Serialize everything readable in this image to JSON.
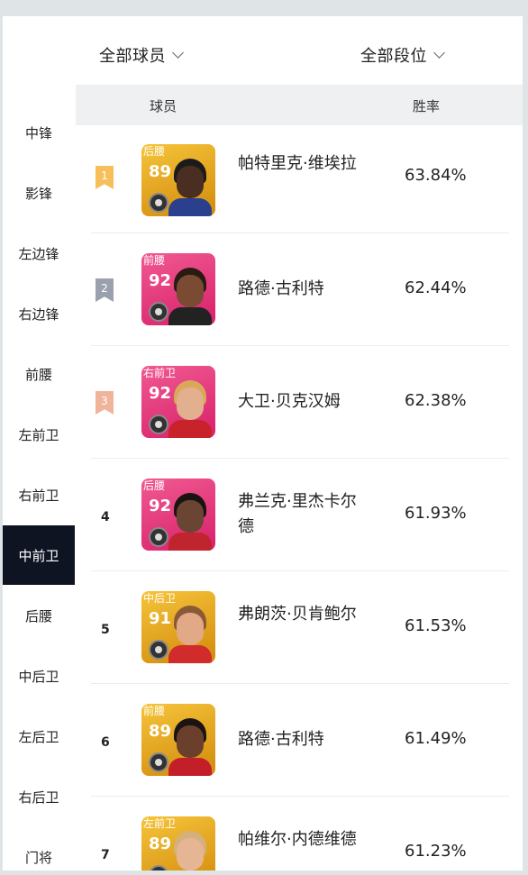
{
  "filters": {
    "players": "全部球员",
    "tier": "全部段位"
  },
  "header": {
    "player_col": "球员",
    "winrate_col": "胜率"
  },
  "positions": [
    "中锋",
    "影锋",
    "左边锋",
    "右边锋",
    "前腰",
    "左前卫",
    "右前卫",
    "中前卫",
    "后腰",
    "中后卫",
    "左后卫",
    "右后卫",
    "门将"
  ],
  "active_position": "中前卫",
  "colors": {
    "gold": "#f3b11a",
    "pink": "#e6357a",
    "active_bg": "#0f1423",
    "header_bg": "#eef0f2"
  },
  "rows": [
    {
      "rank": "1",
      "position": "后腰",
      "rating": "89",
      "name": "帕特里克·维埃拉",
      "winrate": "63.84%"
    },
    {
      "rank": "2",
      "position": "前腰",
      "rating": "92",
      "name": "路德·古利特",
      "winrate": "62.44%"
    },
    {
      "rank": "3",
      "position": "右前卫",
      "rating": "92",
      "name": "大卫·贝克汉姆",
      "winrate": "62.38%"
    },
    {
      "rank": "4",
      "position": "后腰",
      "rating": "92",
      "name": "弗兰克·里杰卡尔德",
      "winrate": "61.93%"
    },
    {
      "rank": "5",
      "position": "中后卫",
      "rating": "91",
      "name": "弗朗茨·贝肯鲍尔",
      "winrate": "61.53%"
    },
    {
      "rank": "6",
      "position": "前腰",
      "rating": "89",
      "name": "路德·古利特",
      "winrate": "61.49%"
    },
    {
      "rank": "7",
      "position": "左前卫",
      "rating": "89",
      "name": "帕维尔·内德维德",
      "winrate": "61.23%"
    }
  ]
}
